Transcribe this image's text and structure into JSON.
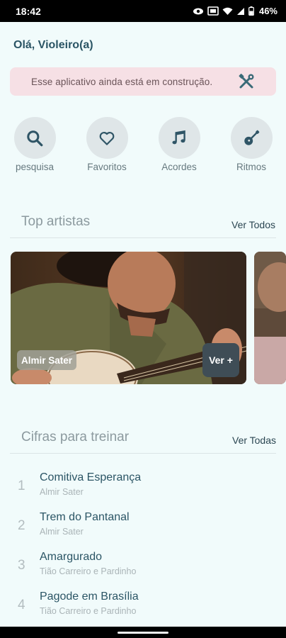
{
  "status_bar": {
    "time": "18:42",
    "battery": "46%",
    "icons": [
      "eye-icon",
      "vibrate-icon",
      "wifi-icon",
      "signal-icon",
      "battery-icon"
    ]
  },
  "greeting": "Olá, Violeiro(a)",
  "banner": {
    "message": "Esse aplicativo ainda está em construção.",
    "icon": "tools-icon",
    "background": "#f6e0e5"
  },
  "shortcuts": [
    {
      "label": "pesquisa",
      "icon": "search-icon"
    },
    {
      "label": "Favoritos",
      "icon": "heart-icon"
    },
    {
      "label": "Acordes",
      "icon": "music-note-icon"
    },
    {
      "label": "Ritmos",
      "icon": "guitar-icon"
    }
  ],
  "top_artists": {
    "title": "Top artistas",
    "see_all": "Ver Todos",
    "cards": [
      {
        "name": "Almir Sater",
        "button": "Ver +"
      }
    ]
  },
  "practice": {
    "title": "Cifras para treinar",
    "see_all": "Ver Todas",
    "songs": [
      {
        "number": "1",
        "title": "Comitiva Esperança",
        "artist": "Almir Sater"
      },
      {
        "number": "2",
        "title": "Trem do Pantanal",
        "artist": "Almir Sater"
      },
      {
        "number": "3",
        "title": "Amargurado",
        "artist": "Tião Carreiro e Pardinho"
      },
      {
        "number": "4",
        "title": "Pagode em Brasília",
        "artist": "Tião Carreiro e Pardinho"
      }
    ]
  },
  "colors": {
    "background": "#f1fbfb",
    "primary_text": "#2b5565",
    "shortcut_circle": "#dfe6e8",
    "button_dark": "#3f4d56"
  }
}
